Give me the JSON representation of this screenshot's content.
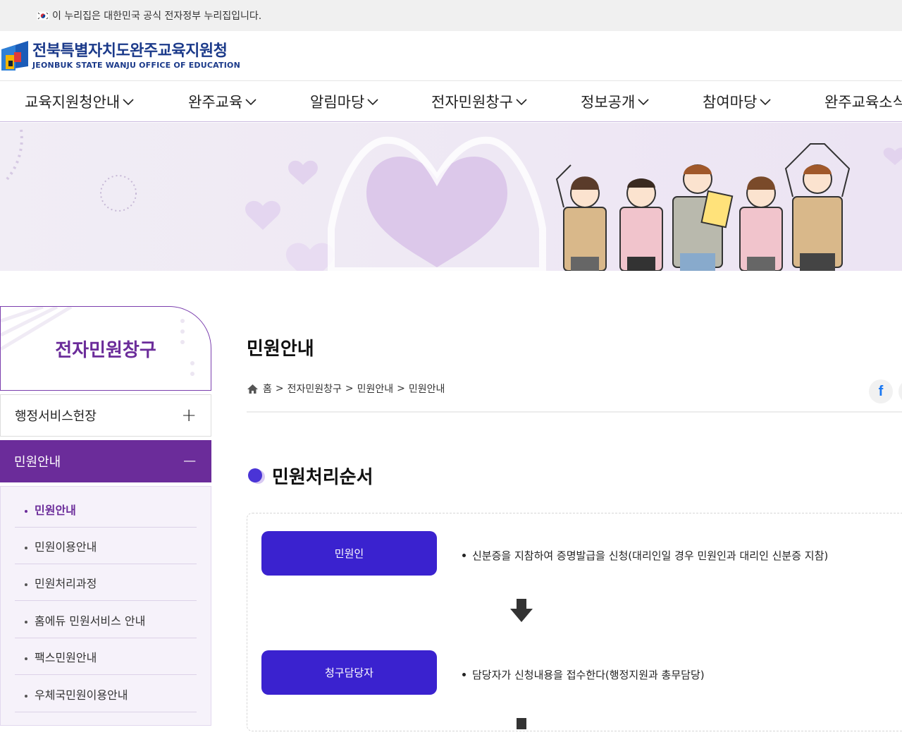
{
  "gov_banner": {
    "text": "이 누리집은 대한민국 공식 전자정부 누리집입니다."
  },
  "logo": {
    "name_ko": "전북특별자치도완주교육지원청",
    "name_en": "JEONBUK STATE WANJU OFFICE OF EDUCATION"
  },
  "gnb": {
    "items": [
      {
        "label": "교육지원청안내"
      },
      {
        "label": "완주교육"
      },
      {
        "label": "알림마당"
      },
      {
        "label": "전자민원창구"
      },
      {
        "label": "정보공개"
      },
      {
        "label": "참여마당"
      },
      {
        "label": "완주교육소식"
      }
    ]
  },
  "sidebar": {
    "title": "전자민원창구",
    "menus": [
      {
        "label": "행정서비스헌장",
        "sign": "+"
      },
      {
        "label": "민원안내",
        "sign": "−"
      }
    ],
    "sub_items": [
      {
        "label": "민원안내"
      },
      {
        "label": "민원이용안내"
      },
      {
        "label": "민원처리과정"
      },
      {
        "label": "홈에듀 민원서비스 안내"
      },
      {
        "label": "팩스민원안내"
      },
      {
        "label": "우체국민원이용안내"
      }
    ]
  },
  "page": {
    "title": "민원안내",
    "breadcrumb": [
      "홈",
      "전자민원창구",
      "민원안내",
      "민원안내"
    ],
    "breadcrumb_sep": ">",
    "share": {
      "facebook": "f"
    },
    "section_title": "민원처리순서"
  },
  "process": {
    "steps": [
      {
        "label": "민원인",
        "desc": "신분증을 지참하여 증명발급을 신청(대리인일 경우 민원인과 대리인 신분증 지참)"
      },
      {
        "label": "청구담당자",
        "desc": "담당자가 신청내용을 접수한다(행정지원과 총무담당)"
      }
    ]
  },
  "colors": {
    "accent_purple": "#6b2c9a",
    "step_blue": "#3a22cf",
    "logo_blue": "#1b3a8a",
    "visual_bg": "#efe9f5"
  },
  "icons": [
    "flag-icon",
    "logo-icon",
    "chevron-down-icon",
    "home-icon",
    "facebook-icon",
    "plus-icon",
    "minus-icon",
    "arrow-down-icon"
  ]
}
